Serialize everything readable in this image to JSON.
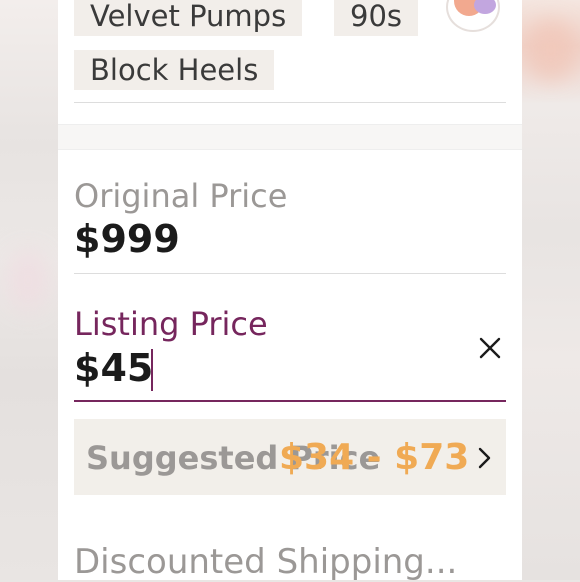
{
  "tags": [
    "Velvet Pumps",
    "90s",
    "Block Heels"
  ],
  "original_price": {
    "label": "Original Price",
    "value": "$999"
  },
  "listing_price": {
    "label": "Listing Price",
    "value": "$45"
  },
  "suggested_price": {
    "label": "Suggested Price",
    "range": "$34 - $73"
  },
  "shipping": {
    "label": "Discounted Shipping..."
  },
  "colors": {
    "accent": "#76265d",
    "suggest_range": "#f0aa54",
    "muted_text": "#9b9896",
    "chip_bg": "#f2eeea"
  },
  "icons": {
    "clear": "close-icon",
    "suggest": "chevron-right-icon",
    "avatar": "avatar"
  }
}
